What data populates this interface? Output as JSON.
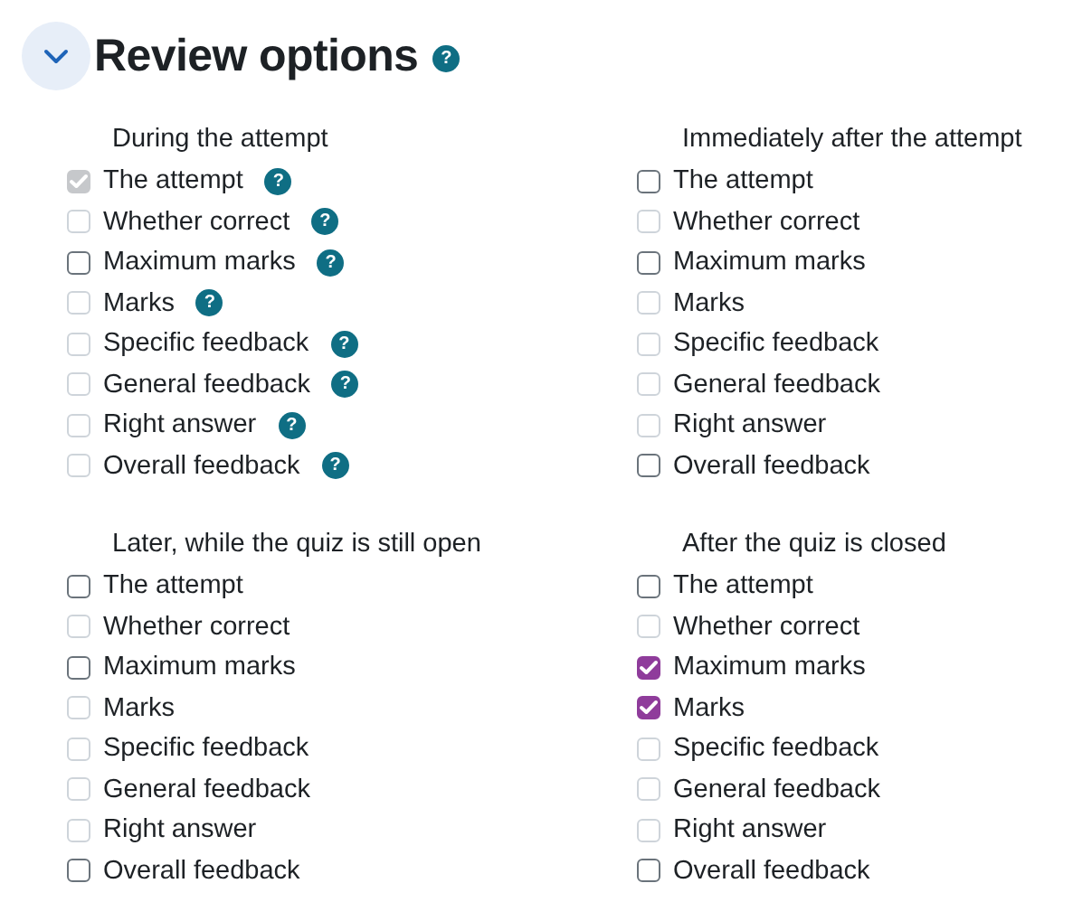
{
  "section": {
    "title": "Review options",
    "help": "?",
    "expanded": true
  },
  "groups": [
    {
      "heading": "During the attempt",
      "options": [
        {
          "label": "The attempt",
          "checked": true,
          "disabled": true,
          "help": "?"
        },
        {
          "label": "Whether correct",
          "checked": false,
          "disabled": true,
          "help": "?"
        },
        {
          "label": "Maximum marks",
          "checked": false,
          "disabled": false,
          "help": "?"
        },
        {
          "label": "Marks",
          "checked": false,
          "disabled": true,
          "help": "?"
        },
        {
          "label": "Specific feedback",
          "checked": false,
          "disabled": true,
          "help": "?"
        },
        {
          "label": "General feedback",
          "checked": false,
          "disabled": true,
          "help": "?"
        },
        {
          "label": "Right answer",
          "checked": false,
          "disabled": true,
          "help": "?"
        },
        {
          "label": "Overall feedback",
          "checked": false,
          "disabled": true,
          "help": "?"
        }
      ]
    },
    {
      "heading": "Immediately after the attempt",
      "options": [
        {
          "label": "The attempt",
          "checked": false,
          "disabled": false
        },
        {
          "label": "Whether correct",
          "checked": false,
          "disabled": true
        },
        {
          "label": "Maximum marks",
          "checked": false,
          "disabled": false
        },
        {
          "label": "Marks",
          "checked": false,
          "disabled": true
        },
        {
          "label": "Specific feedback",
          "checked": false,
          "disabled": true
        },
        {
          "label": "General feedback",
          "checked": false,
          "disabled": true
        },
        {
          "label": "Right answer",
          "checked": false,
          "disabled": true
        },
        {
          "label": "Overall feedback",
          "checked": false,
          "disabled": false
        }
      ]
    },
    {
      "heading": "Later, while the quiz is still open",
      "options": [
        {
          "label": "The attempt",
          "checked": false,
          "disabled": false
        },
        {
          "label": "Whether correct",
          "checked": false,
          "disabled": true
        },
        {
          "label": "Maximum marks",
          "checked": false,
          "disabled": false
        },
        {
          "label": "Marks",
          "checked": false,
          "disabled": true
        },
        {
          "label": "Specific feedback",
          "checked": false,
          "disabled": true
        },
        {
          "label": "General feedback",
          "checked": false,
          "disabled": true
        },
        {
          "label": "Right answer",
          "checked": false,
          "disabled": true
        },
        {
          "label": "Overall feedback",
          "checked": false,
          "disabled": false
        }
      ]
    },
    {
      "heading": "After the quiz is closed",
      "options": [
        {
          "label": "The attempt",
          "checked": false,
          "disabled": false
        },
        {
          "label": "Whether correct",
          "checked": false,
          "disabled": true
        },
        {
          "label": "Maximum marks",
          "checked": true,
          "disabled": false
        },
        {
          "label": "Marks",
          "checked": true,
          "disabled": false
        },
        {
          "label": "Specific feedback",
          "checked": false,
          "disabled": true
        },
        {
          "label": "General feedback",
          "checked": false,
          "disabled": true
        },
        {
          "label": "Right answer",
          "checked": false,
          "disabled": true
        },
        {
          "label": "Overall feedback",
          "checked": false,
          "disabled": false
        }
      ]
    }
  ]
}
